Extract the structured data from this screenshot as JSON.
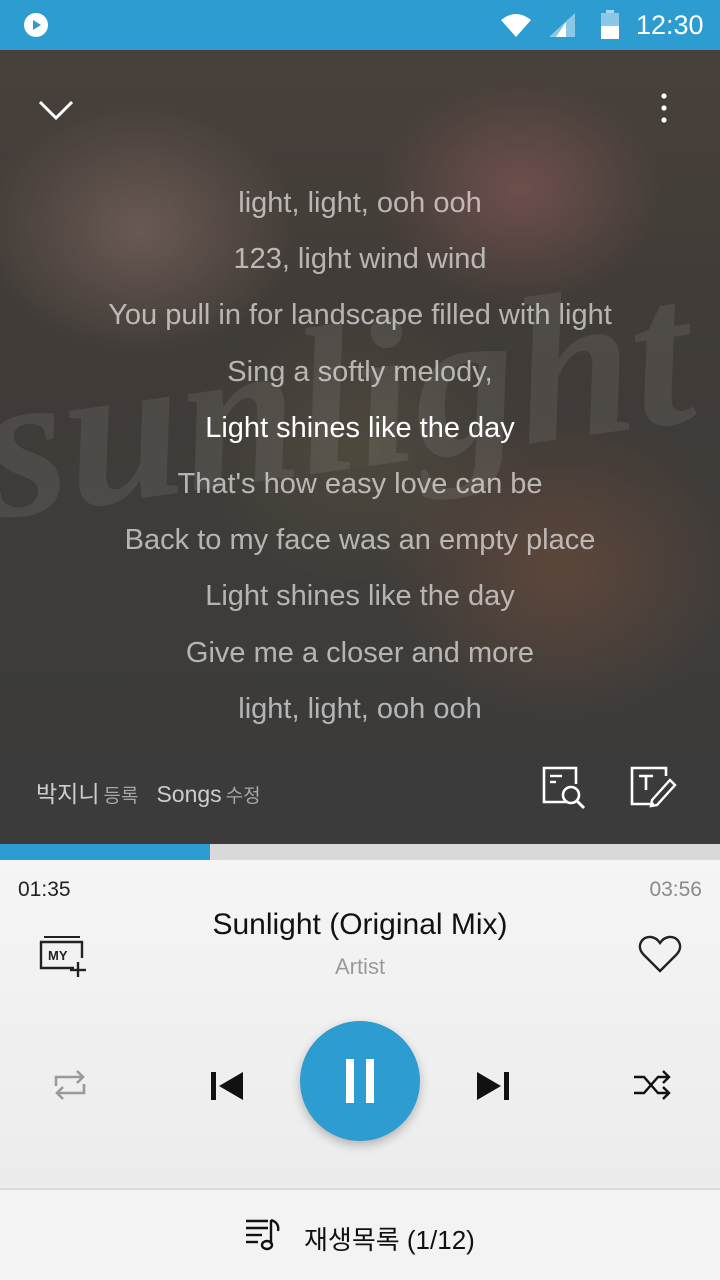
{
  "status_bar": {
    "time": "12:30",
    "icons": [
      "app-play-icon",
      "wifi-icon",
      "signal-icon",
      "battery-icon"
    ]
  },
  "lyrics": {
    "watermark": "sunlight",
    "lines": [
      "light, light, ooh ooh",
      "123, light wind wind",
      "You pull in for landscape filled with light",
      "Sing a softly melody,",
      "Light shines like the day",
      "That's how easy love can be",
      "Back to my face was an empty place",
      "Light shines like the day",
      "Give me a closer and more",
      "light, light, ooh ooh"
    ],
    "current_index": 4,
    "credits": {
      "lyricist": "박지니",
      "lyricist_action": "등록",
      "songs": "Songs",
      "songs_action": "수정"
    }
  },
  "progress": {
    "fraction": 0.292
  },
  "player": {
    "elapsed": "01:35",
    "total": "03:56",
    "title": "Sunlight (Original Mix)",
    "artist": "Artist",
    "add_my_label": "MY",
    "accent": "#2d9cd0"
  },
  "playlist": {
    "label": "재생목록 (1/12)"
  }
}
